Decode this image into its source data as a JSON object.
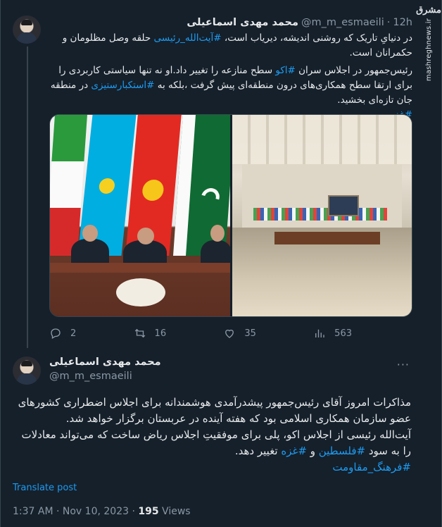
{
  "watermark": {
    "logo": "مشرق",
    "url": "mashreghnews.ir"
  },
  "tweet1": {
    "name": "محمد مهدی اسماعیلی",
    "handle": "@m_m_esmaeili",
    "separator": "·",
    "time": "12h",
    "para1_a": "در دنیایِ تاریک که روشنی اندیشه، دیریاب است، ",
    "para1_tag": "#آیت‌الله_رئیسی",
    "para1_b": " حلقه وصل مظلومان و حکمرانان است.",
    "para2_a": "رئیس‌جمهور در اجلاس سران ",
    "para2_tag1": "#اکو",
    "para2_b": " سطح منازعه را تغییر داد.او نه تنها سیاستی کاربردی را برای ارتقا سطح همکاری‌های درون منطقه‌ای پیش گرفت ،بلکه به ",
    "para2_tag2": "#استکبارستیزی",
    "para2_c": " در منطقه جان تازه‌ای بخشید.",
    "para3_tag": "#غزه",
    "actions": {
      "replies": "2",
      "retweets": "16",
      "likes": "35",
      "views": "563"
    }
  },
  "tweet2": {
    "name": "محمد مهدی اسماعیلی",
    "handle": "@m_m_esmaeili",
    "more": "···",
    "body1": "مذاکرات امروز آقای رئیس‌جمهور پیشدرآمدی هوشمندانه برای اجلاس اضطراری کشورهای عضو سازمان همکاری اسلامی بود که هفته آینده در عربستان برگزار خواهد شد.",
    "body2_a": "آیت‌الله رئیسی از اجلاس اکو، پلی برای موفقیتِ اجلاس ریاض ساخت که می‌تواند معادلات را به سود ",
    "body2_tag1": "#فلسطین",
    "body2_and": " و ",
    "body2_tag2": "#غزه",
    "body2_b": " تغییر دهد.",
    "body3_tag": "#فرهنگ_مقاومت",
    "translate": "Translate post",
    "date": "1:37 AM · Nov 10, 2023 · ",
    "views_count": "195",
    "views_label": " Views"
  }
}
